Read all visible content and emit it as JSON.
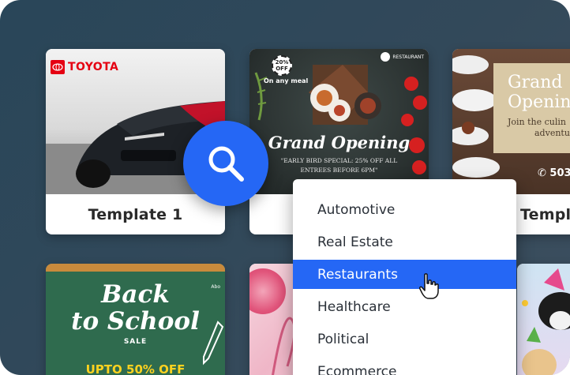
{
  "templates": [
    {
      "label": "Template 1",
      "brand": "TOYOTA"
    },
    {
      "title": "Grand Opening",
      "subtitle": "\"EARLY BIRD SPECIAL: 25% OFF ALL ENTREES BEFORE 6PM\"",
      "badge_top": "20%",
      "badge_bottom": "OFF",
      "tagline": "On any meal",
      "tag": "RESTAURANT"
    },
    {
      "label": "Template",
      "title_line1": "Grand",
      "title_line2": "Opening",
      "sub_line1": "Join the culin",
      "sub_line2": "adventure",
      "phone": "503"
    },
    {
      "title_line1": "Back",
      "title_line2": "to School",
      "sale": "SALE",
      "promo": "UPTO 50% OFF",
      "corner": "Abo"
    }
  ],
  "dropdown": {
    "items": [
      "Automotive",
      "Real Estate",
      "Restaurants",
      "Healthcare",
      "Political",
      "Ecommerce"
    ],
    "selected": "Restaurants"
  },
  "colors": {
    "accent": "#2567f5",
    "background": "#294659"
  }
}
